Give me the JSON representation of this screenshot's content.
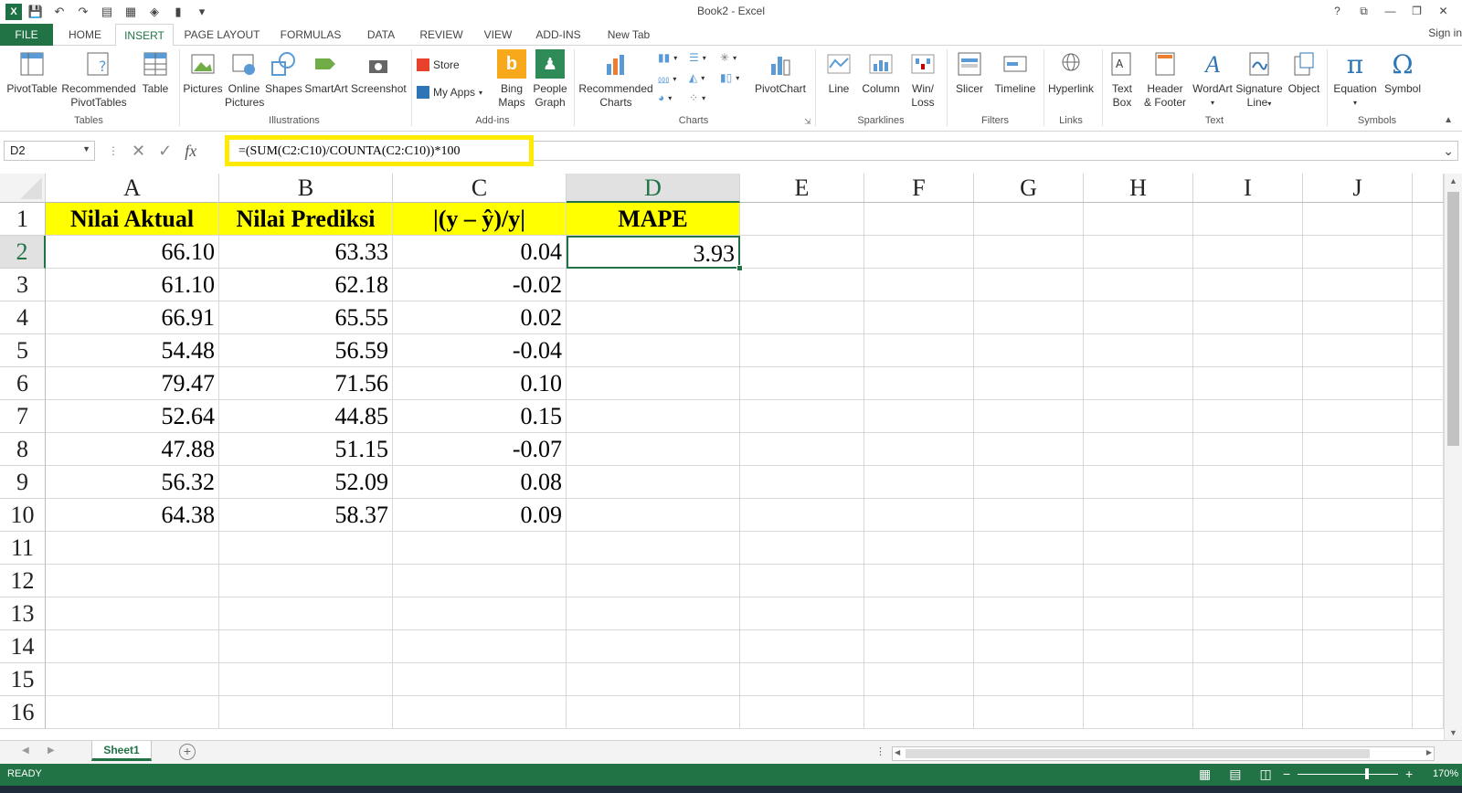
{
  "window": {
    "title": "Book2 - Excel",
    "controls": {
      "help": "?",
      "ribbon_display": "⧉",
      "minimize": "—",
      "restore": "❐",
      "close": "✕"
    }
  },
  "tabs": [
    "FILE",
    "HOME",
    "INSERT",
    "PAGE LAYOUT",
    "FORMULAS",
    "DATA",
    "REVIEW",
    "VIEW",
    "ADD-INS",
    "New Tab"
  ],
  "active_tab": "INSERT",
  "signin": "Sign in",
  "ribbon": {
    "groups": {
      "tables": "Tables",
      "illustrations": "Illustrations",
      "addins": "Add-ins",
      "charts": "Charts",
      "sparklines": "Sparklines",
      "filters": "Filters",
      "links": "Links",
      "text": "Text",
      "symbols": "Symbols"
    },
    "buttons": {
      "pivottable": "PivotTable",
      "recommended_pivot_1": "Recommended",
      "recommended_pivot_2": "PivotTables",
      "table": "Table",
      "pictures": "Pictures",
      "online_pictures_1": "Online",
      "online_pictures_2": "Pictures",
      "shapes": "Shapes",
      "smartart": "SmartArt",
      "screenshot": "Screenshot",
      "store": "Store",
      "my_apps": "My Apps",
      "bing_maps_1": "Bing",
      "bing_maps_2": "Maps",
      "people_graph_1": "People",
      "people_graph_2": "Graph",
      "recommended_charts_1": "Recommended",
      "recommended_charts_2": "Charts",
      "pivotchart": "PivotChart",
      "line": "Line",
      "column": "Column",
      "winloss_1": "Win/",
      "winloss_2": "Loss",
      "slicer": "Slicer",
      "timeline": "Timeline",
      "hyperlink": "Hyperlink",
      "textbox_1": "Text",
      "textbox_2": "Box",
      "header_footer_1": "Header",
      "header_footer_2": "& Footer",
      "wordart": "WordArt",
      "signature_1": "Signature",
      "signature_2": "Line",
      "object": "Object",
      "equation": "Equation",
      "symbol": "Symbol"
    }
  },
  "formula_bar": {
    "name_box": "D2",
    "formula": "=(SUM(C2:C10)/COUNTA(C2:C10))*100",
    "fx": "fx"
  },
  "grid": {
    "columns": [
      "A",
      "B",
      "C",
      "D",
      "E",
      "F",
      "G",
      "H",
      "I",
      "J"
    ],
    "rows": [
      "1",
      "2",
      "3",
      "4",
      "5",
      "6",
      "7",
      "8",
      "9",
      "10",
      "11",
      "12",
      "13",
      "14",
      "15",
      "16"
    ],
    "selected_col": "D",
    "selected_row": "2",
    "headers": [
      "Nilai Aktual",
      "Nilai Prediksi",
      "|(y – ŷ)/y|",
      "MAPE"
    ],
    "data": [
      [
        "66.10",
        "63.33",
        "0.04",
        "3.93"
      ],
      [
        "61.10",
        "62.18",
        "-0.02",
        ""
      ],
      [
        "66.91",
        "65.55",
        "0.02",
        ""
      ],
      [
        "54.48",
        "56.59",
        "-0.04",
        ""
      ],
      [
        "79.47",
        "71.56",
        "0.10",
        ""
      ],
      [
        "52.64",
        "44.85",
        "0.15",
        ""
      ],
      [
        "47.88",
        "51.15",
        "-0.07",
        ""
      ],
      [
        "56.32",
        "52.09",
        "0.08",
        ""
      ],
      [
        "64.38",
        "58.37",
        "0.09",
        ""
      ]
    ]
  },
  "sheets": [
    "Sheet1"
  ],
  "status": {
    "ready": "READY",
    "zoom": "170%"
  },
  "colors": {
    "excel_green": "#217346",
    "header_fill": "#ffff00",
    "formula_highlight": "#ffea00"
  }
}
